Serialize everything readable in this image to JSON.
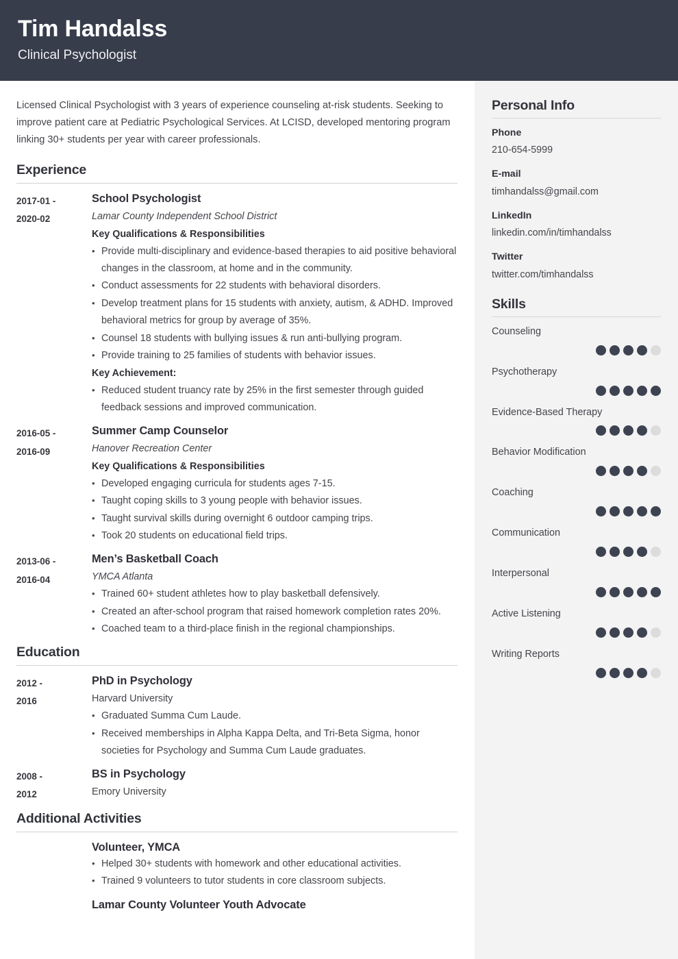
{
  "header": {
    "name": "Tim Handalss",
    "job_title": "Clinical Psychologist",
    "bg_color": "#373d4b"
  },
  "summary": "Licensed Clinical Psychologist with 3 years of experience counseling at-risk students. Seeking to improve patient care at Pediatric Psychological Services. At LCISD, developed mentoring program linking 30+ students per year with career professionals.",
  "sections": {
    "experience": {
      "heading": "Experience",
      "entries": [
        {
          "date": "2017-01 - 2020-02",
          "title": "School Psychologist",
          "subtitle": "Lamar County Independent School District",
          "kicker": "Key Qualifications & Responsibilities",
          "bullets": [
            "Provide multi-disciplinary and evidence-based therapies to aid positive behavioral changes in the classroom, at home and in the community.",
            "Conduct assessments for 22 students with behavioral disorders.",
            "Develop treatment plans for 15 students with anxiety, autism, & ADHD. Improved behavioral metrics for group by average of 35%.",
            "Counsel 18 students with bullying issues & run anti-bullying program.",
            "Provide training to 25 families of students with behavior issues."
          ],
          "kicker2": "Key Achievement:",
          "bullets2": [
            "Reduced student truancy rate by 25% in the first semester through guided feedback sessions and improved communication."
          ]
        },
        {
          "date": "2016-05 - 2016-09",
          "title": "Summer Camp Counselor",
          "subtitle": "Hanover Recreation Center",
          "kicker": "Key Qualifications & Responsibilities",
          "bullets": [
            "Developed engaging curricula for students ages 7-15.",
            "Taught coping skills to 3 young people with behavior issues.",
            "Taught survival skills during overnight 6 outdoor camping trips.",
            "Took 20 students on educational field trips."
          ]
        },
        {
          "date": "2013-06 - 2016-04",
          "title": "Men’s Basketball Coach",
          "subtitle": "YMCA Atlanta",
          "bullets": [
            "Trained 60+ student athletes how to play basketball defensively.",
            "Created an after-school program that raised homework completion rates 20%.",
            "Coached team to a third-place finish in the regional championships."
          ]
        }
      ]
    },
    "education": {
      "heading": "Education",
      "entries": [
        {
          "date": "2012 - 2016",
          "title": "PhD in Psychology",
          "subtitle": "Harvard University",
          "bullets": [
            "Graduated Summa Cum Laude.",
            "Received memberships in Alpha Kappa Delta, and Tri-Beta Sigma, honor societies for Psychology and Summa Cum Laude graduates."
          ]
        },
        {
          "date": "2008 - 2012",
          "title": "BS in Psychology",
          "subtitle": "Emory University",
          "bullets": []
        }
      ]
    },
    "additional": {
      "heading": "Additional Activities",
      "entries": [
        {
          "date": "",
          "title": "Volunteer, YMCA",
          "subtitle": "",
          "bullets": [
            "Helped 30+ students with homework and other educational activities.",
            "Trained 9 volunteers to tutor students in core classroom subjects."
          ]
        },
        {
          "date": "",
          "title": "Lamar County Volunteer Youth Advocate",
          "subtitle": "",
          "bullets": []
        }
      ]
    }
  },
  "sidebar": {
    "personal_info": {
      "heading": "Personal Info",
      "items": [
        {
          "label": "Phone",
          "value": "210-654-5999"
        },
        {
          "label": "E-mail",
          "value": "timhandalss@gmail.com"
        },
        {
          "label": "LinkedIn",
          "value": "linkedin.com/in/timhandalss"
        },
        {
          "label": "Twitter",
          "value": "twitter.com/timhandalss"
        }
      ]
    },
    "skills": {
      "heading": "Skills",
      "max_rating": 5,
      "filled_color": "#3d4351",
      "empty_color": "#dcdcdc",
      "items": [
        {
          "name": "Counseling",
          "rating": 4
        },
        {
          "name": "Psychotherapy",
          "rating": 5
        },
        {
          "name": "Evidence-Based Therapy",
          "rating": 4
        },
        {
          "name": "Behavior Modification",
          "rating": 4
        },
        {
          "name": "Coaching",
          "rating": 5
        },
        {
          "name": "Communication",
          "rating": 4
        },
        {
          "name": "Interpersonal",
          "rating": 5
        },
        {
          "name": "Active Listening",
          "rating": 4
        },
        {
          "name": "Writing Reports",
          "rating": 4
        }
      ]
    }
  }
}
